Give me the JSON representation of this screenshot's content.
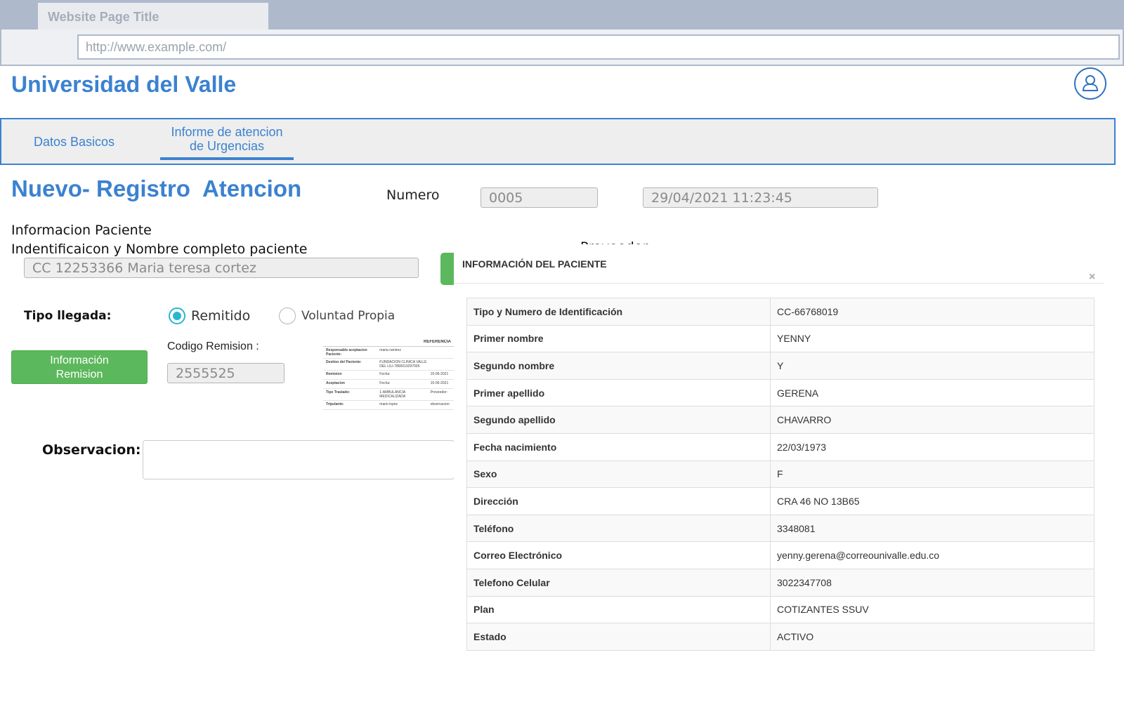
{
  "browser": {
    "tab_title": "Website Page Title",
    "url": "http://www.example.com/"
  },
  "header": {
    "brand": "Universidad del Valle",
    "user_icon": "user-icon"
  },
  "nav": {
    "tabs": [
      {
        "label": "Datos Basicos"
      },
      {
        "label": "Informe de atencion de Urgencias",
        "line1": "Informe de atencion",
        "line2": "de Urgencias",
        "active": true
      }
    ]
  },
  "form": {
    "title": "Nuevo- Registro  Atencion",
    "numero_label": "Numero",
    "numero_value": "0005",
    "fecha_value": "29/04/2021 11:23:45",
    "section_title": "Informacion Paciente",
    "patient_label": "Indentificaicon y Nombre completo paciente",
    "patient_value": "CC 12253366 Maria teresa cortez",
    "provider_label": "Proveedor:",
    "tipo_llegada_label": "Tipo llegada:",
    "radio_options": [
      {
        "label": "Remitido",
        "checked": true
      },
      {
        "label": "Voluntad Propia",
        "checked": false
      }
    ],
    "remision_button_line1": "Información",
    "remision_button_line2": "Remision",
    "codigo_label": "Codigo Remision :",
    "codigo_value": "2555525",
    "observacion_label": "Observacion:",
    "accent_green": "#5cb85c",
    "accent_blue": "#3b82d0"
  },
  "referral_doc": {
    "header": "REFERENCIA",
    "rows": [
      {
        "a": "Responsable aceptacion Paciente:",
        "b": "maria ramirez",
        "c": ""
      },
      {
        "a": "Destino del Paciente:",
        "b": "FUNDACION CLINICA VALLE DEL LILI-7800019297005",
        "c": ""
      },
      {
        "a": "Remision",
        "b": "Fecha:",
        "c": "15-06-2021"
      },
      {
        "a": "Aceptacion",
        "b": "Fecha:",
        "c": "15-06-2021"
      },
      {
        "a": "Tipo Traslado:",
        "b": "1-AMBULANCIA MEDICALIZADA",
        "c": "Proveedor:"
      },
      {
        "a": "Tripulante:",
        "b": "mario lopez",
        "c": "observacion"
      }
    ]
  },
  "modal": {
    "title": "INFORMACIÓN DEL PACIENTE",
    "close": "×",
    "rows": [
      {
        "label": "Tipo y Numero de Identificación",
        "value": "CC-66768019"
      },
      {
        "label": "Primer nombre",
        "value": "YENNY"
      },
      {
        "label": "Segundo nombre",
        "value": "Y"
      },
      {
        "label": "Primer apellido",
        "value": "GERENA"
      },
      {
        "label": "Segundo apellido",
        "value": "CHAVARRO"
      },
      {
        "label": "Fecha nacimiento",
        "value": "22/03/1973"
      },
      {
        "label": "Sexo",
        "value": "F"
      },
      {
        "label": "Dirección",
        "value": "CRA 46 NO 13B65"
      },
      {
        "label": "Teléfono",
        "value": "3348081"
      },
      {
        "label": "Correo Electrónico",
        "value": "yenny.gerena@correounivalle.edu.co"
      },
      {
        "label": "Telefono Celular",
        "value": "3022347708"
      },
      {
        "label": "Plan",
        "value": "COTIZANTES SSUV"
      },
      {
        "label": "Estado",
        "value": "ACTIVO"
      }
    ]
  }
}
